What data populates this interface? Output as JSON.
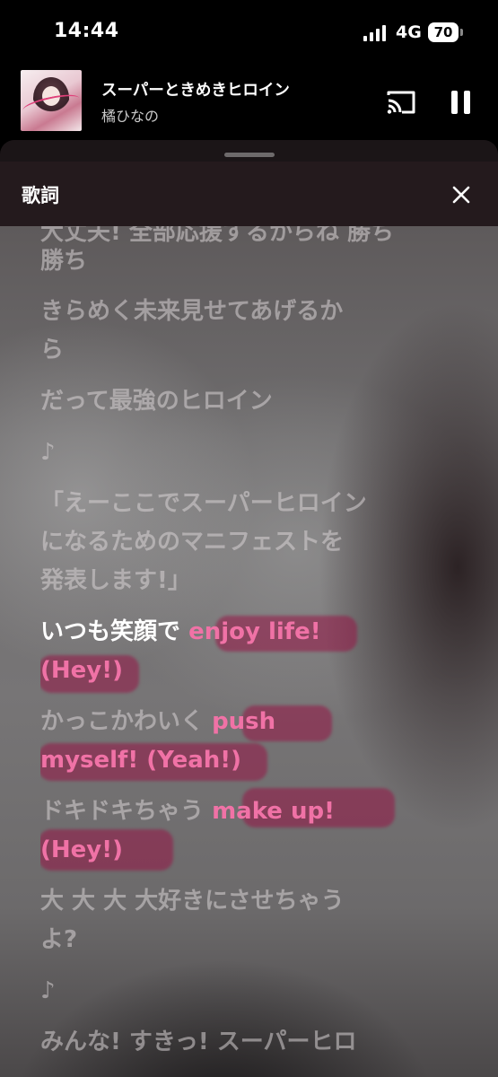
{
  "status_bar": {
    "time": "14:44",
    "network": "4G",
    "battery": "70"
  },
  "now_playing": {
    "title": "スーパーときめきヒロイン",
    "artist": "橘ひなの",
    "is_playing": true
  },
  "sheet": {
    "title": "歌詞"
  },
  "lyrics": {
    "lines": [
      {
        "text": "大丈夫! 全部応援するからね 勝ち",
        "partial": true
      },
      {
        "text": "勝ち"
      },
      {
        "text": "きらめく未来見せてあげるか"
      },
      {
        "text": "ら"
      },
      {
        "text": "だって最強のヒロイン"
      },
      {
        "text": "♪"
      },
      {
        "text": "「えーここでスーパーヒロイン"
      },
      {
        "text": "になるためのマニフェストを"
      },
      {
        "text": "発表します!」"
      },
      {
        "text": "いつも笑顔で ",
        "highlight": "enjoy life!",
        "active": true
      },
      {
        "text": "",
        "highlight": "(Hey!)",
        "active": true
      },
      {
        "text": "かっこかわいく ",
        "highlight": "push"
      },
      {
        "text": "",
        "highlight": "myself! (Yeah!)"
      },
      {
        "text": "ドキドキちゃう ",
        "highlight": "make up!"
      },
      {
        "text": "",
        "highlight": "(Hey!)"
      },
      {
        "text": "大 大 大 大好きにさせちゃう"
      },
      {
        "text": "よ?"
      },
      {
        "text": "♪"
      },
      {
        "text": "みんな! すきっ! スーパーヒロ"
      }
    ]
  },
  "colors": {
    "highlight_text": "#f072a6",
    "highlight_marker": "#961446",
    "active_line": "#ffffff"
  }
}
